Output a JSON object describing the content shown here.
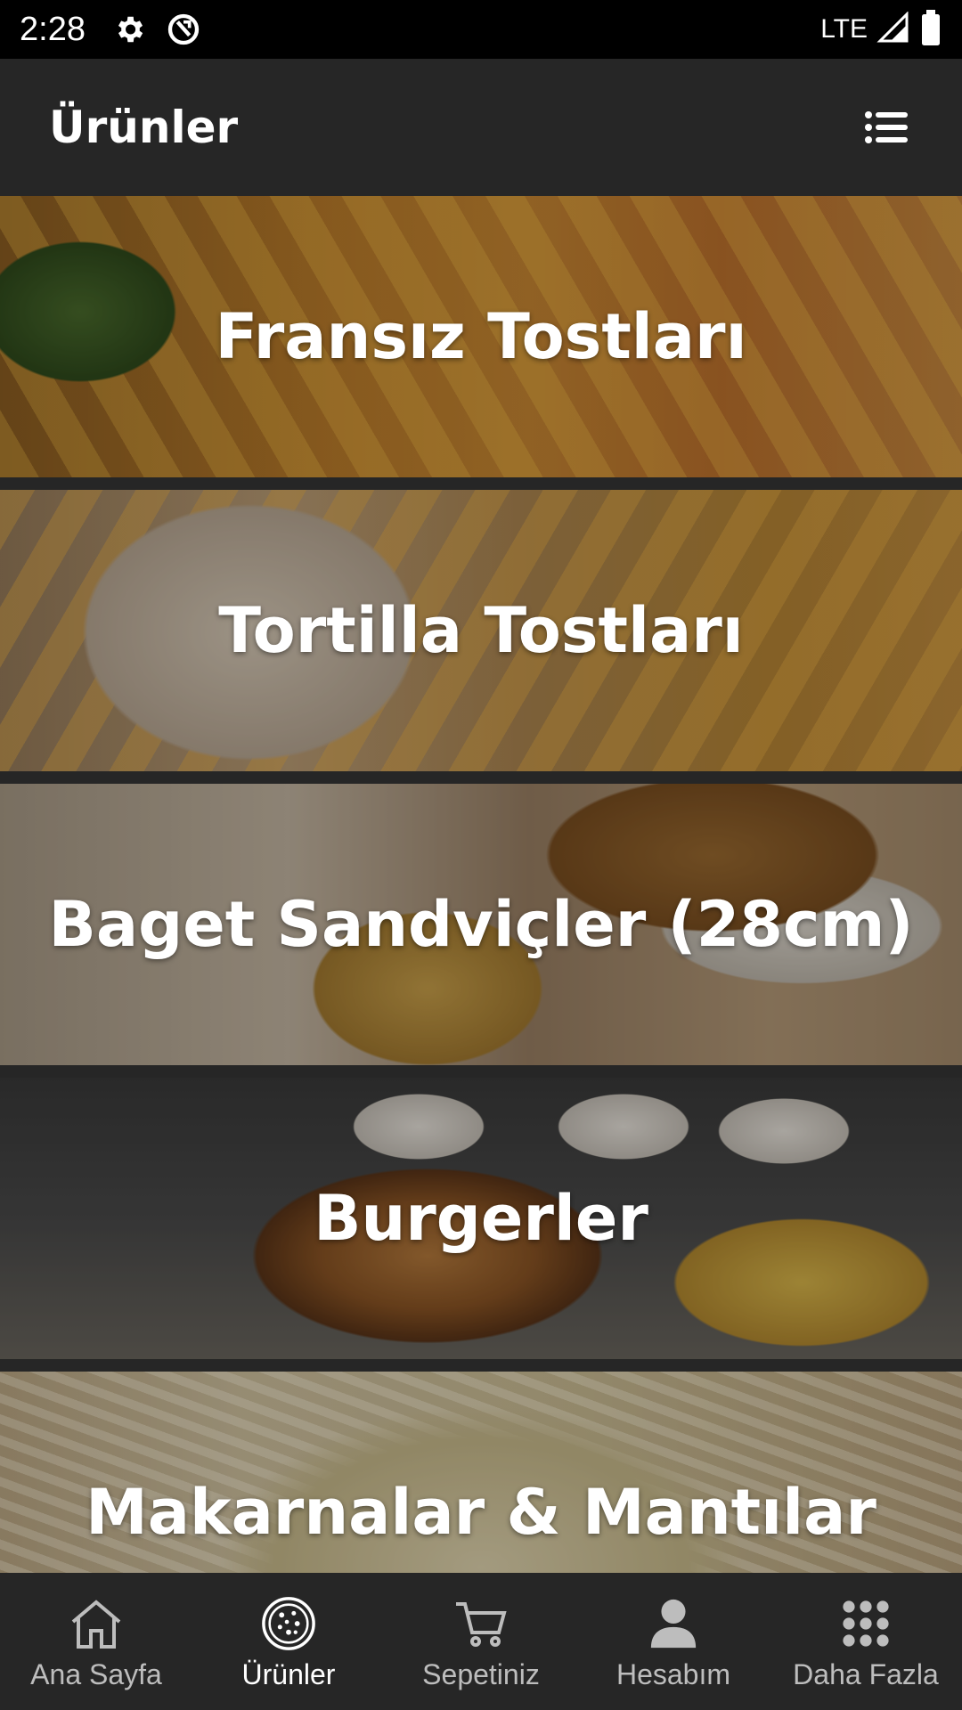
{
  "status_bar": {
    "time": "2:28",
    "network": "LTE",
    "icons": [
      "settings-icon",
      "sync-icon",
      "signal-icon",
      "battery-icon"
    ]
  },
  "app_bar": {
    "title": "Ürünler",
    "menu_icon": "list-icon"
  },
  "categories": [
    {
      "title": "Fransız Tostları"
    },
    {
      "title": "Tortilla Tostları"
    },
    {
      "title": "Baget Sandviçler (28cm)"
    },
    {
      "title": "Burgerler"
    },
    {
      "title": "Makarnalar & Mantılar"
    }
  ],
  "bottom_nav": {
    "items": [
      {
        "label": "Ana Sayfa",
        "icon": "home-icon",
        "active": false
      },
      {
        "label": "Ürünler",
        "icon": "pizza-icon",
        "active": true
      },
      {
        "label": "Sepetiniz",
        "icon": "cart-icon",
        "active": false
      },
      {
        "label": "Hesabım",
        "icon": "person-icon",
        "active": false
      },
      {
        "label": "Daha Fazla",
        "icon": "apps-grid-icon",
        "active": false
      }
    ]
  },
  "colors": {
    "background": "#262626",
    "status_bar": "#000000",
    "nav_active": "#ffffff",
    "nav_inactive": "#bdbdbd"
  }
}
